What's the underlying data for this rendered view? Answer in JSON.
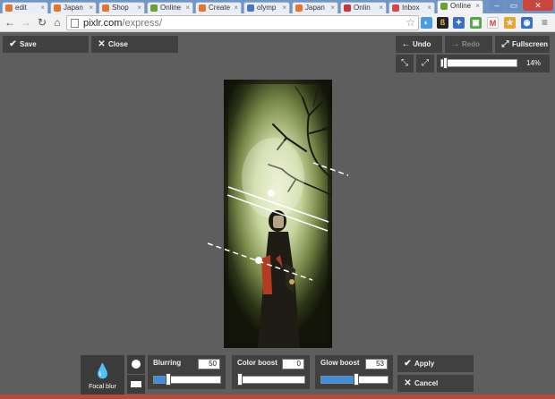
{
  "browser": {
    "tabs": [
      {
        "label": "edit",
        "color": "#e8732b"
      },
      {
        "label": "Japan",
        "color": "#e8732b"
      },
      {
        "label": "Shop",
        "color": "#e8732b"
      },
      {
        "label": "Online",
        "color": "#6ba133"
      },
      {
        "label": "Create",
        "color": "#e8732b"
      },
      {
        "label": "olymp",
        "color": "#4a73c9"
      },
      {
        "label": "Japan",
        "color": "#e8732b"
      },
      {
        "label": "Onlin",
        "color": "#c33"
      },
      {
        "label": "Inbox",
        "color": "#d44"
      },
      {
        "label": "Online",
        "color": "#6ba133"
      }
    ],
    "url_host": "pixlr.com",
    "url_path": "/express/",
    "icons": {
      "back": "back-arrow-icon",
      "forward": "forward-arrow-icon",
      "reload": "reload-icon",
      "home": "home-icon",
      "star": "bookmark-star-icon"
    }
  },
  "editor": {
    "save_label": "Save",
    "close_label": "Close",
    "undo_label": "Undo",
    "redo_label": "Redo",
    "fullscreen_label": "Fullscreen",
    "zoom_label": "14%",
    "zoom_level": 0.03
  },
  "focal_blur": {
    "tool_label": "Focal blur",
    "blurring": {
      "label": "Blurring",
      "value": "50",
      "level": 0.22
    },
    "color_boost": {
      "label": "Color boost",
      "value": "0",
      "level": 0.0
    },
    "glow_boost": {
      "label": "Glow boost",
      "value": "53",
      "level": 0.52
    },
    "apply_label": "Apply",
    "cancel_label": "Cancel"
  },
  "colors": {
    "panel": "#404040",
    "background": "#5e5e5e",
    "slider_fill": "#3d8ee0"
  }
}
